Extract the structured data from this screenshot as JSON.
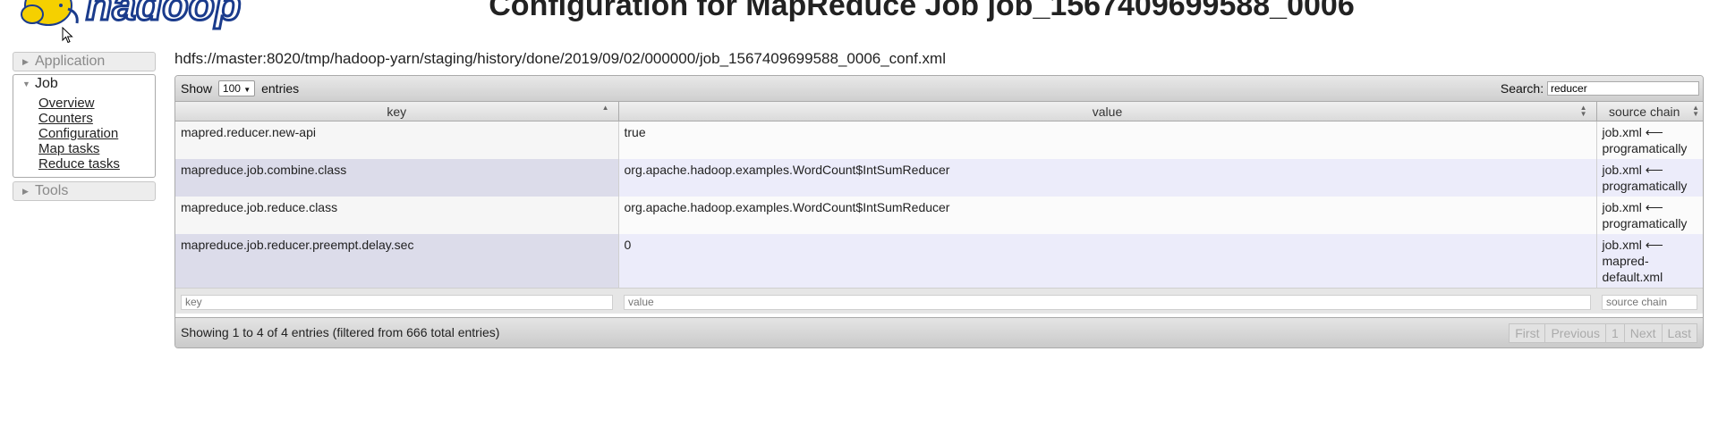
{
  "header": {
    "title": "Configuration for MapReduce Job job_1567409699588_0006",
    "logo_text": "hadoop"
  },
  "sidebar": {
    "sections": [
      {
        "label": "Application",
        "open": false
      },
      {
        "label": "Job",
        "open": true
      },
      {
        "label": "Tools",
        "open": false
      }
    ],
    "job_links": [
      "Overview",
      "Counters",
      "Configuration",
      "Map tasks",
      "Reduce tasks"
    ]
  },
  "main": {
    "path": "hdfs://master:8020/tmp/hadoop-yarn/staging/history/done/2019/09/02/000000/job_1567409699588_0006_conf.xml",
    "show_label": "Show",
    "entries_label": "entries",
    "page_length": "100",
    "search_label": "Search:",
    "search_value": "reducer",
    "columns": [
      "key",
      "value",
      "source chain"
    ],
    "rows": [
      {
        "key": "mapred.reducer.new-api",
        "value": "true",
        "source": "job.xml ⟵ programatically"
      },
      {
        "key": "mapreduce.job.combine.class",
        "value": "org.apache.hadoop.examples.WordCount$IntSumReducer",
        "source": "job.xml ⟵ programatically"
      },
      {
        "key": "mapreduce.job.reduce.class",
        "value": "org.apache.hadoop.examples.WordCount$IntSumReducer",
        "source": "job.xml ⟵ programatically"
      },
      {
        "key": "mapreduce.job.reducer.preempt.delay.sec",
        "value": "0",
        "source": "job.xml ⟵ mapred-default.xml"
      }
    ],
    "filters": {
      "key": "key",
      "value": "value",
      "source": "source chain"
    },
    "info": "Showing 1 to 4 of 4 entries (filtered from 666 total entries)",
    "pager": [
      "First",
      "Previous",
      "1",
      "Next",
      "Last"
    ]
  },
  "colors": {
    "odd_row": "#fbfbfb",
    "even_row": "#ececfa",
    "logo_yellow": "#f5d000",
    "logo_blue": "#1a3b8c"
  }
}
